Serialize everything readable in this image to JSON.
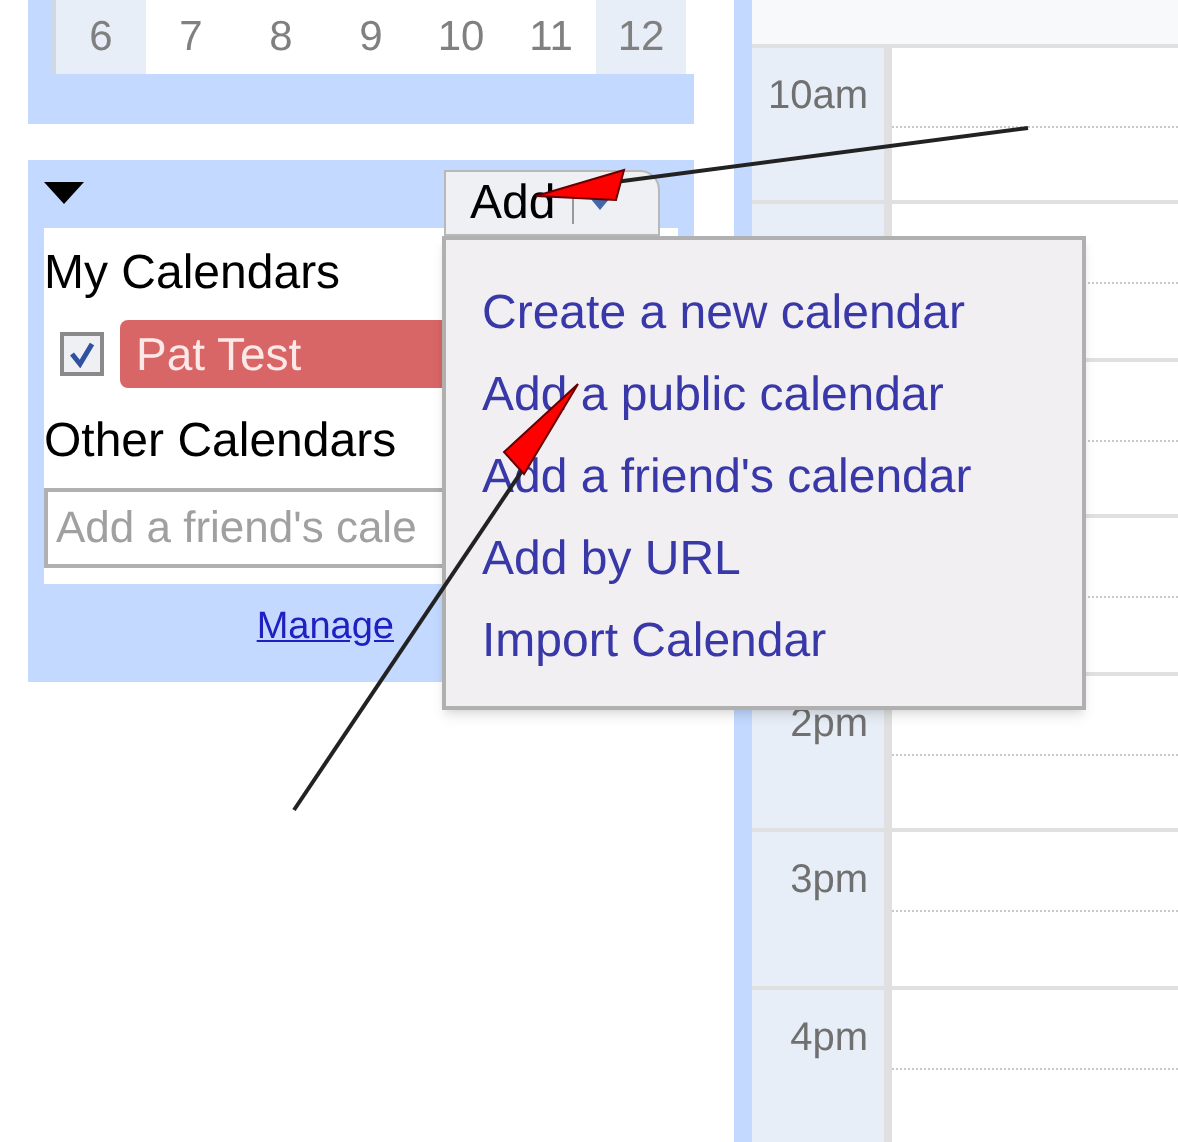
{
  "mini_calendar": {
    "days": [
      {
        "label": "6",
        "shaded": true
      },
      {
        "label": "7",
        "shaded": false
      },
      {
        "label": "8",
        "shaded": false
      },
      {
        "label": "9",
        "shaded": false
      },
      {
        "label": "10",
        "shaded": false
      },
      {
        "label": "11",
        "shaded": false
      },
      {
        "label": "12",
        "shaded": true
      }
    ]
  },
  "calendars_panel": {
    "add_button": "Add",
    "my_calendars_heading": "My Calendars",
    "my_calendars": [
      {
        "name": "Pat Test",
        "checked": true,
        "color": "#d96666"
      }
    ],
    "other_calendars_heading": "Other Calendars",
    "friend_field": {
      "placeholder": "Add a friend's cale"
    },
    "manage_link": "Manage"
  },
  "add_menu": {
    "items": [
      "Create a new calendar",
      "Add a public calendar",
      "Add a friend's calendar",
      "Add by URL",
      "Import Calendar"
    ]
  },
  "time_grid": {
    "hours": [
      {
        "kind": "labeled",
        "label": "10am"
      },
      {
        "kind": "partly_covered"
      },
      {
        "kind": "covered"
      },
      {
        "kind": "covered"
      },
      {
        "kind": "labeled",
        "label": "2pm"
      },
      {
        "kind": "labeled",
        "label": "3pm"
      },
      {
        "kind": "labeled",
        "label": "4pm"
      }
    ]
  }
}
